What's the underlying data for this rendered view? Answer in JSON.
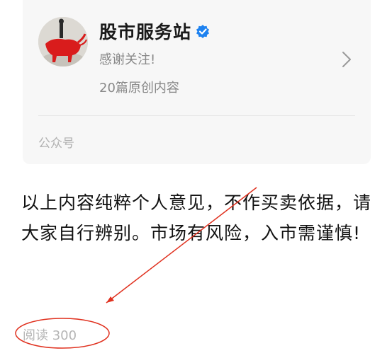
{
  "account_card": {
    "name": "股市服务站",
    "subtitle": "感谢关注!",
    "article_count": "20篇原创内容",
    "type_label": "公众号",
    "verified_color": "#1e82f0"
  },
  "article": {
    "closing_text": "以上内容纯粹个人意见，不作买卖依据，请大家自行辨别。市场有风险，入市需谨慎!",
    "read_count": "阅读 300"
  },
  "annotation": {
    "color": "#e0311f"
  }
}
